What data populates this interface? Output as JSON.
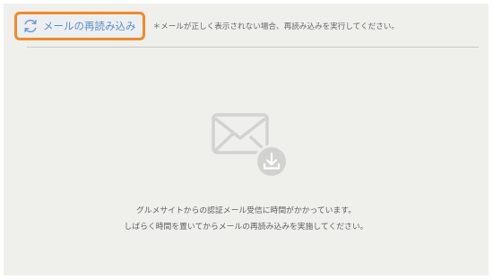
{
  "toolbar": {
    "reload_label": "メールの再読み込み",
    "notice": "＊メールが正しく表示されない場合、再読み込みを実行してください。"
  },
  "icons": {
    "reload": "reload-icon",
    "envelope": "envelope-icon",
    "download": "download-icon"
  },
  "colors": {
    "accent_border": "#f28a2a",
    "link_text": "#5b8fc9",
    "panel_background": "#efefec"
  },
  "message": {
    "line1": "グルメサイトからの認証メール受信に時間がかかっています。",
    "line2": "しばらく時間を置いてからメールの再読み込みを実施してください。"
  }
}
